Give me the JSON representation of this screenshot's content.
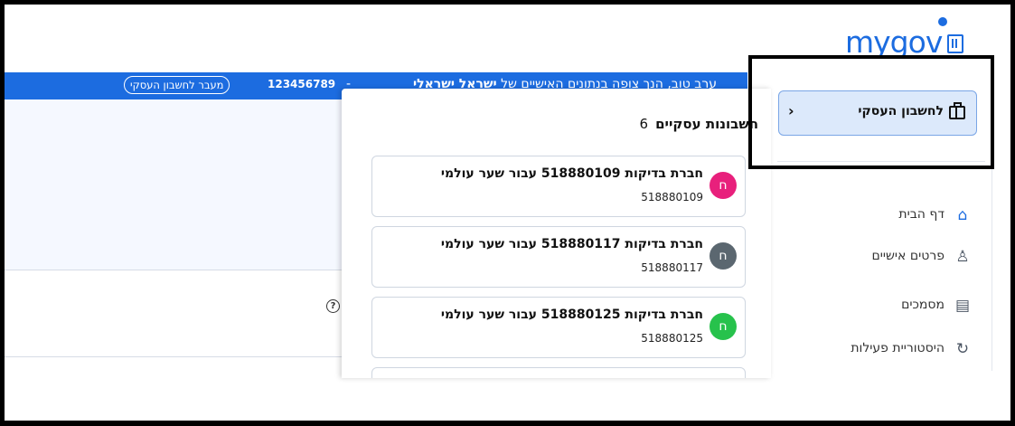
{
  "header": {
    "logo_text": "mygov",
    "emblem_icon": "state-emblem-icon"
  },
  "topbar": {
    "greeting_prefix": "ערב טוב, הנך צופה בנתונים האישיים של",
    "user_name": "ישראל ישראלי",
    "separator": "-",
    "id_number": "123456789",
    "switch_label": "מעבר לחשבון העסקי",
    "color": "#1c6ce0"
  },
  "dropdown": {
    "title": "חשבונות עסקיים",
    "count": "6",
    "accounts": [
      {
        "name": "חברת בדיקות 518880109 עבור שער עולמי",
        "number": "518880109",
        "initial": "ח",
        "color": "#e8207c"
      },
      {
        "name": "חברת בדיקות 518880117 עבור שער עולמי",
        "number": "518880117",
        "initial": "ח",
        "color": "#5b6770"
      },
      {
        "name": "חברת בדיקות 518880125 עבור שער עולמי",
        "number": "518880125",
        "initial": "ח",
        "color": "#27c24c"
      }
    ]
  },
  "sidebar": {
    "business_button_label": "לחשבון העסקי",
    "business_icon": "briefcase-icon",
    "chevron_icon": "chevron-left-icon",
    "items": [
      {
        "label": "דף הבית",
        "icon": "home-icon"
      },
      {
        "label": "פרטים אישיים",
        "icon": "person-icon"
      },
      {
        "label": "מסמכים",
        "icon": "document-icon"
      },
      {
        "label": "היסטוריית פעילות",
        "icon": "refresh-icon"
      }
    ]
  },
  "help_icon": "help-icon"
}
